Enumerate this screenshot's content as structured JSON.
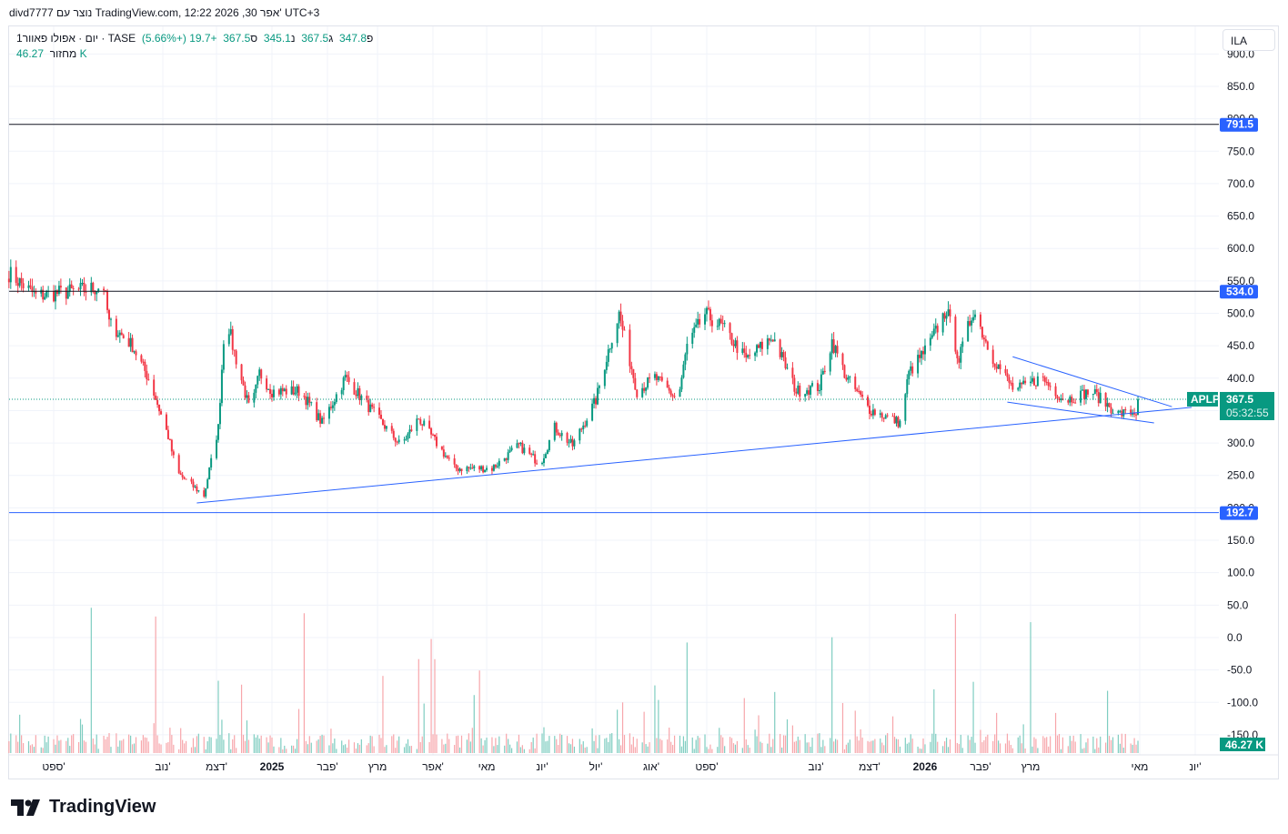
{
  "header": {
    "created_by": "divd7777 נוצר עם TradingView.com, 12:22 2026 ,30 אפר' UTC+3"
  },
  "legend": {
    "symbol": "1יום · אפולו פאוור · TASE",
    "open_label": "פ",
    "open": "347.8",
    "high_label": "ג",
    "high": "367.5",
    "low_label": "נ",
    "low": "345.1",
    "close_label": "ס",
    "close": "367.5",
    "change": "+19.7 (+5.66%)",
    "volume_label": "מחזור",
    "volume": "46.27 K"
  },
  "currency_button": "ILA",
  "price_tag": {
    "ticker": "APLP",
    "price": "367.5",
    "countdown": "05:32:55"
  },
  "volume_tag": "46.27 K",
  "logo_text": "TradingView",
  "colors": {
    "up": "#089981",
    "down": "#f23645",
    "line": "#2962ff",
    "dark_line": "#131722",
    "up_vol": "#7fcdc1",
    "down_vol": "#f7a6ab"
  },
  "chart_data": {
    "type": "candlestick",
    "title": "APLP · TASE · 1D",
    "ylim": [
      -175,
      910
    ],
    "y_ticks": [
      "900.0",
      "850.0",
      "800.0",
      "750.0",
      "700.0",
      "650.0",
      "600.0",
      "550.0",
      "500.0",
      "450.0",
      "400.0",
      "350.0",
      "300.0",
      "250.0",
      "200.0",
      "150.0",
      "100.0",
      "50.0",
      "0.0",
      "-50.0",
      "-100.0",
      "-150.0"
    ],
    "x_ticks": [
      {
        "label": "ספט'",
        "date": "2024-09-01"
      },
      {
        "label": "נוב'",
        "date": "2024-11-01"
      },
      {
        "label": "דצמ'",
        "date": "2024-12-01"
      },
      {
        "label": "2025",
        "date": "2025-01-01",
        "bold": true
      },
      {
        "label": "פבר'",
        "date": "2025-02-01"
      },
      {
        "label": "מרץ",
        "date": "2025-03-01"
      },
      {
        "label": "אפר'",
        "date": "2025-04-01"
      },
      {
        "label": "מאי",
        "date": "2025-05-01"
      },
      {
        "label": "יונ'",
        "date": "2025-06-01"
      },
      {
        "label": "יול'",
        "date": "2025-07-01"
      },
      {
        "label": "אוג'",
        "date": "2025-08-01"
      },
      {
        "label": "ספט'",
        "date": "2025-09-01"
      },
      {
        "label": "נוב'",
        "date": "2025-11-01"
      },
      {
        "label": "דצמ'",
        "date": "2025-12-01"
      },
      {
        "label": "2026",
        "date": "2026-01-01",
        "bold": true
      },
      {
        "label": "פבר'",
        "date": "2026-02-01"
      },
      {
        "label": "מרץ",
        "date": "2026-03-01"
      },
      {
        "label": "מאי",
        "date": "2026-05-01"
      },
      {
        "label": "יונ'",
        "date": "2026-06-01"
      }
    ],
    "close_anchors": [
      [
        "2024-08-07",
        562
      ],
      [
        "2024-08-22",
        527
      ],
      [
        "2024-09-12",
        534
      ],
      [
        "2024-09-29",
        541
      ],
      [
        "2024-10-02",
        485
      ],
      [
        "2024-10-15",
        450
      ],
      [
        "2024-10-25",
        394
      ],
      [
        "2024-11-04",
        310
      ],
      [
        "2024-11-09",
        254
      ],
      [
        "2024-11-24",
        219
      ],
      [
        "2024-12-02",
        324
      ],
      [
        "2024-12-06",
        506
      ],
      [
        "2024-12-10",
        450
      ],
      [
        "2024-12-20",
        345
      ],
      [
        "2024-12-25",
        408
      ],
      [
        "2025-01-01",
        380
      ],
      [
        "2025-01-17",
        380
      ],
      [
        "2025-01-29",
        331
      ],
      [
        "2025-02-11",
        401
      ],
      [
        "2025-02-21",
        366
      ],
      [
        "2025-03-14",
        296
      ],
      [
        "2025-03-24",
        338
      ],
      [
        "2025-04-13",
        261
      ],
      [
        "2025-05-04",
        261
      ],
      [
        "2025-05-19",
        296
      ],
      [
        "2025-05-31",
        268
      ],
      [
        "2025-06-08",
        324
      ],
      [
        "2025-06-18",
        296
      ],
      [
        "2025-07-01",
        366
      ],
      [
        "2025-07-10",
        464
      ],
      [
        "2025-07-14",
        499
      ],
      [
        "2025-07-24",
        380
      ],
      [
        "2025-08-03",
        401
      ],
      [
        "2025-08-16",
        366
      ],
      [
        "2025-08-21",
        450
      ],
      [
        "2025-08-31",
        499
      ],
      [
        "2025-09-10",
        478
      ],
      [
        "2025-09-23",
        429
      ],
      [
        "2025-10-08",
        464
      ],
      [
        "2025-10-21",
        380
      ],
      [
        "2025-11-03",
        387
      ],
      [
        "2025-11-10",
        457
      ],
      [
        "2025-11-18",
        401
      ],
      [
        "2025-12-01",
        352
      ],
      [
        "2025-12-18",
        331
      ],
      [
        "2025-12-23",
        408
      ],
      [
        "2026-01-03",
        450
      ],
      [
        "2026-01-13",
        506
      ],
      [
        "2026-01-20",
        429
      ],
      [
        "2026-01-28",
        506
      ],
      [
        "2026-02-07",
        436
      ],
      [
        "2026-02-20",
        380
      ],
      [
        "2026-03-07",
        401
      ],
      [
        "2026-03-20",
        366
      ],
      [
        "2026-04-04",
        380
      ],
      [
        "2026-04-19",
        345
      ],
      [
        "2026-04-29",
        347.8
      ],
      [
        "2026-04-30",
        367.5
      ]
    ],
    "horizontal_lines": [
      {
        "price": 791.5,
        "label": "791.5",
        "color": "#131722"
      },
      {
        "price": 534.0,
        "label": "534.0",
        "color": "#131722"
      },
      {
        "price": 192.7,
        "label": "192.7",
        "color": "#2962ff"
      }
    ],
    "trend_lines": [
      {
        "from": [
          "2024-11-20",
          207.5
        ],
        "to": [
          "2026-05-30",
          355
        ]
      },
      {
        "from": [
          "2026-02-19",
          433
        ],
        "to": [
          "2026-05-19",
          356
        ]
      },
      {
        "from": [
          "2026-02-16",
          363
        ],
        "to": [
          "2026-05-09",
          331
        ]
      }
    ],
    "last_price": 367.5
  }
}
